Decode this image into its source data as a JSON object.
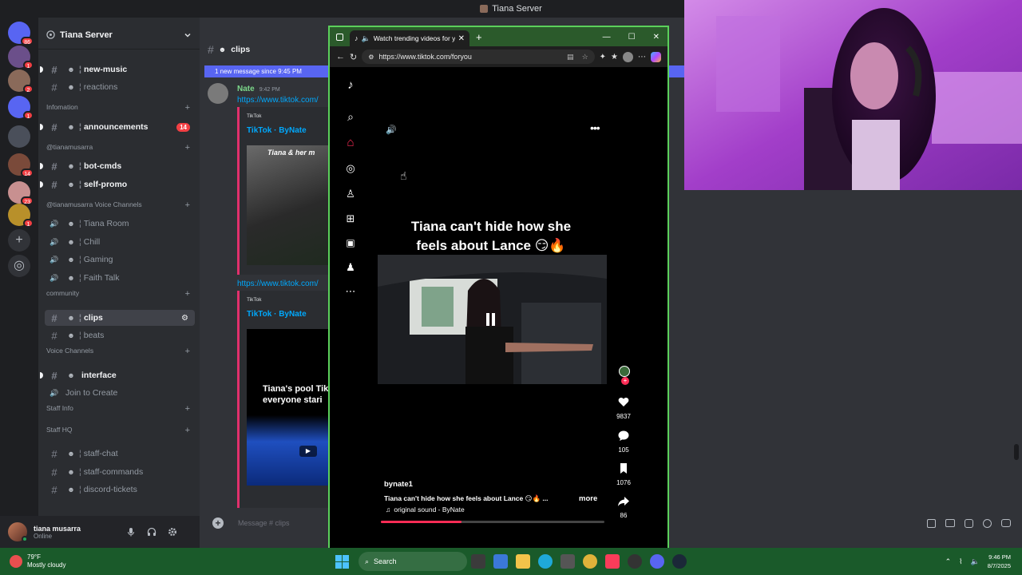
{
  "window_title": "Tiana Server",
  "colors": {
    "accent": "#5865f2",
    "tiktok_red": "#fe2c55",
    "window_border": "#5bd05b",
    "taskbar": "#1a5a2a"
  },
  "servers": [
    {
      "icon": "discord-icon",
      "badge": "86"
    },
    {
      "icon": "server-avatar-icon",
      "badge": "1"
    },
    {
      "icon": "server-avatar-icon",
      "badge": "2"
    },
    {
      "icon": "discord-icon",
      "badge": "1"
    },
    {
      "icon": "server-avatar-icon",
      "badge": ""
    },
    {
      "icon": "server-avatar-icon",
      "badge": "14"
    },
    {
      "icon": "server-avatar-icon",
      "badge": "23"
    },
    {
      "icon": "server-avatar-icon",
      "badge": "1"
    }
  ],
  "sidebar": {
    "server_name": "Tiana Server",
    "items": [
      {
        "kind": "channel",
        "label": "new-music",
        "bright": true,
        "unread": true
      },
      {
        "kind": "channel",
        "label": "reactions",
        "bright": false
      },
      {
        "kind": "category",
        "label": "Infomation"
      },
      {
        "kind": "channel",
        "label": "announcements",
        "bright": true,
        "unread": true,
        "badge": "14"
      },
      {
        "kind": "category",
        "label": "@tianamusarra"
      },
      {
        "kind": "channel",
        "label": "bot-cmds",
        "bright": true,
        "unread": true
      },
      {
        "kind": "channel",
        "label": "self-promo",
        "bright": true,
        "unread": true
      },
      {
        "kind": "category",
        "label": "@tianamusarra Voice Channels"
      },
      {
        "kind": "voice",
        "label": "Tiana Room"
      },
      {
        "kind": "voice",
        "label": "Chill"
      },
      {
        "kind": "voice",
        "label": "Gaming"
      },
      {
        "kind": "voice",
        "label": "Faith Talk"
      },
      {
        "kind": "category",
        "label": "community"
      },
      {
        "kind": "channel",
        "label": "clips",
        "bright": true,
        "selected": true
      },
      {
        "kind": "channel",
        "label": "beats",
        "bright": false
      },
      {
        "kind": "category",
        "label": "Voice Channels"
      },
      {
        "kind": "channel",
        "label": "interface",
        "bright": true,
        "unread": true
      },
      {
        "kind": "voice",
        "label": "Join to Create"
      },
      {
        "kind": "category",
        "label": "Staff Info"
      },
      {
        "kind": "category",
        "label": "Staff HQ"
      },
      {
        "kind": "channel",
        "label": "staff-chat",
        "bright": false
      },
      {
        "kind": "channel",
        "label": "staff-commands",
        "bright": false
      },
      {
        "kind": "channel",
        "label": "discord-tickets",
        "bright": false
      }
    ]
  },
  "user": {
    "name": "tiana musarra",
    "status": "Online"
  },
  "chat": {
    "channel_name": "clips",
    "new_messages_bar": "1 new message since 9:45 PM",
    "message_author": "Nate",
    "message_time": "9:42 PM",
    "link": "https://www.tiktok.com/",
    "embed_provider": "TikTok",
    "embed_title": "TikTok · ByNate",
    "thumb1_caption": "Tiana & her m",
    "thumb2_caption": "Tiana's pool Tik everyone stari",
    "input_placeholder": "Message #",
    "input_channel": "clips"
  },
  "browser": {
    "tab_title": "Watch trending videos for y",
    "url": "https://www.tiktok.com/foryou"
  },
  "tiktok": {
    "overlay_title": "Tiana can't hide how she feels about Lance 😏🔥",
    "author": "bynate1",
    "caption": "Tiana can't hide how she feels about Lance 😏🔥 ...",
    "more": "more",
    "sound": "original sound - ByNate",
    "likes": "9837",
    "comments": "105",
    "saves": "1076",
    "shares": "86",
    "progress": 0.36
  },
  "taskbar": {
    "weather_temp": "79°F",
    "weather_desc": "Mostly cloudy",
    "search": "Search",
    "time": "9:46 PM",
    "date": "8/7/2025"
  }
}
